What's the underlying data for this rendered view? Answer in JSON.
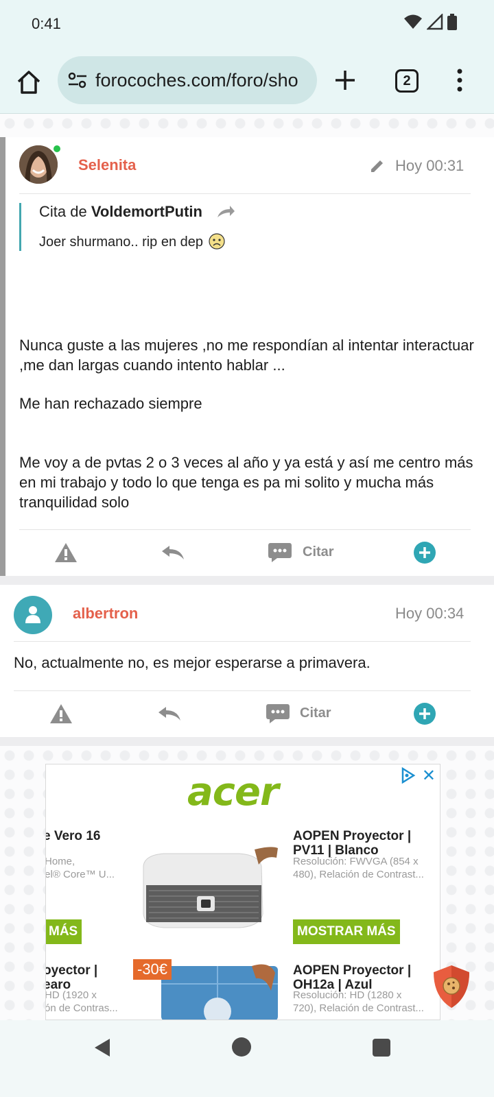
{
  "status_bar": {
    "time": "0:41"
  },
  "browser": {
    "url": "forocoches.com/foro/sho",
    "tab_count": "2"
  },
  "posts": [
    {
      "username": "Selenita",
      "time": "Hoy 00:31",
      "quote": {
        "prefix": "Cita de",
        "author": "VoldemortPutin",
        "text": "Joer shurmano.. rip en dep"
      },
      "paragraphs": [
        "Nunca guste a las mujeres ,no me respondían al intentar interactuar ,me dan largas cuando intento hablar ...",
        "Me han rechazado siempre",
        "Me voy a de pvtas 2 o 3 veces al año y ya está y así me centro más en mi trabajo y todo lo que tenga es pa mi solito y mucha más tranquilidad solo"
      ],
      "actions": {
        "quote_label": "Citar"
      }
    },
    {
      "username": "albertron",
      "time": "Hoy 00:34",
      "text": "No, actualmente no, es mejor esperarse a primavera.",
      "actions": {
        "quote_label": "Citar"
      }
    }
  ],
  "ad": {
    "brand": "acer",
    "products": [
      {
        "title": "e Vero 16",
        "desc1": "Home,",
        "desc2": "tel® Core™ U...",
        "button": "MÁS"
      },
      {
        "title": "AOPEN Proyector | PV11 | Blanco",
        "desc1": "Resolución: FWVGA (854 x",
        "desc2": "480), Relación de Contrast...",
        "button": "MOSTRAR MÁS"
      },
      {
        "title": "oyector |",
        "title2": "earo",
        "desc1": "HD (1920 x",
        "desc2": "ón de Contras..."
      },
      {
        "title": "AOPEN Proyector | OH12a | Azul",
        "desc1": "Resolución: HD (1280 x",
        "desc2": "720), Relación de Contrast..."
      }
    ],
    "discount": "-30€"
  },
  "colors": {
    "accent": "#43a7b0",
    "username": "#e4604b",
    "acer_green": "#83b81a"
  }
}
